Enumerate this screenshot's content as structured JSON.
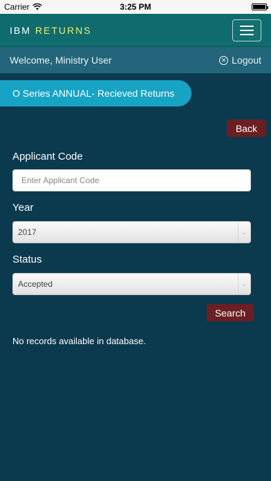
{
  "status_bar": {
    "carrier": "Carrier",
    "time": "3:25 PM"
  },
  "header": {
    "brand_ibm": "IBM",
    "brand_returns": "RETURNS",
    "menu_icon": "hamburger-menu-icon"
  },
  "welcome": {
    "text": "Welcome, Ministry User",
    "logout_label": "Logout",
    "logout_icon": "close-circle-icon"
  },
  "page": {
    "title": "O Series ANNUAL- Recieved Returns",
    "back_label": "Back",
    "search_label": "Search",
    "empty_message": "No records available in database."
  },
  "form": {
    "applicant_code": {
      "label": "Applicant Code",
      "placeholder": "Enter Applicant Code",
      "value": ""
    },
    "year": {
      "label": "Year",
      "selected": "2017"
    },
    "status": {
      "label": "Status",
      "selected": "Accepted"
    }
  },
  "colors": {
    "background": "#0b3a4e",
    "header": "#0f6b6e",
    "welcome_bar": "#23657a",
    "title_pill": "#17a3c4",
    "button": "#6b1f23",
    "brand_accent": "#e9f26b"
  }
}
